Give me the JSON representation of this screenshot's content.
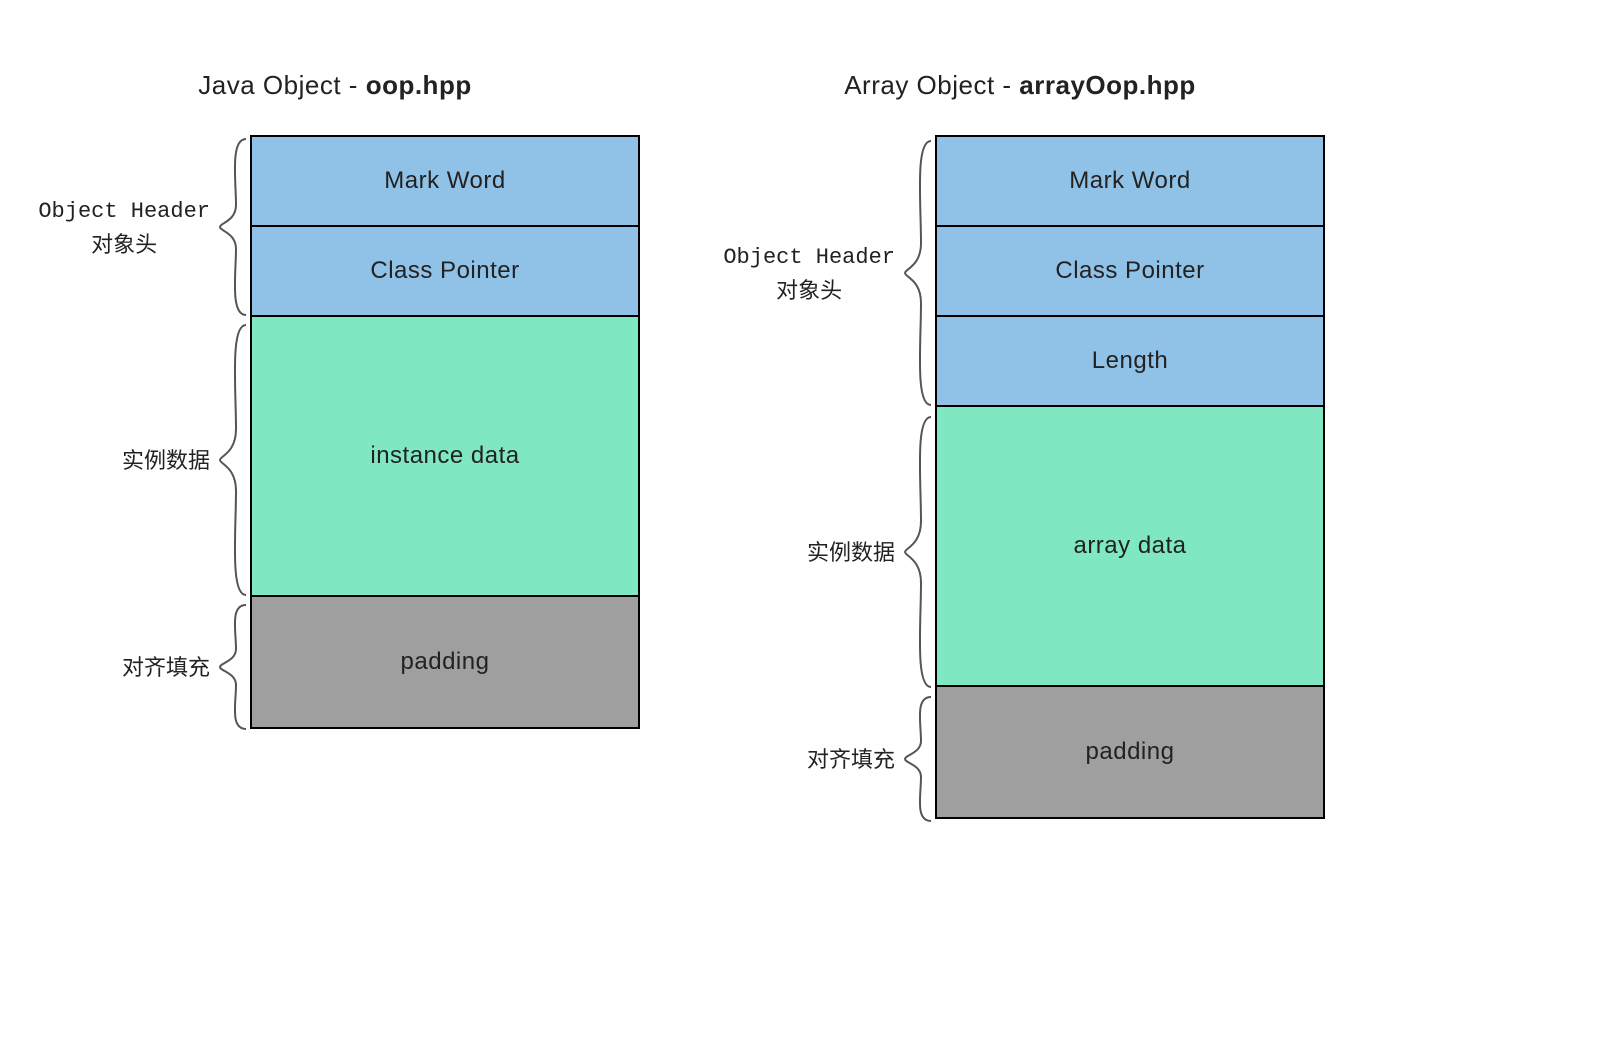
{
  "colors": {
    "header": "#90c1e7",
    "data": "#7fe7c1",
    "padding": "#9f9f9f"
  },
  "left": {
    "title_prefix": "Java Object - ",
    "title_bold": "oop.hpp",
    "sections": {
      "header": {
        "label_en": "Object Header",
        "label_cn": "对象头",
        "cells": [
          "Mark Word",
          "Class Pointer"
        ]
      },
      "data": {
        "label_cn": "实例数据",
        "cells": [
          "instance data"
        ]
      },
      "pad": {
        "label_cn": "对齐填充",
        "cells": [
          "padding"
        ]
      }
    }
  },
  "right": {
    "title_prefix": "Array Object - ",
    "title_bold": "arrayOop.hpp",
    "sections": {
      "header": {
        "label_en": "Object Header",
        "label_cn": "对象头",
        "cells": [
          "Mark Word",
          "Class Pointer",
          "Length"
        ]
      },
      "data": {
        "label_cn": "实例数据",
        "cells": [
          "array data"
        ]
      },
      "pad": {
        "label_cn": "对齐填充",
        "cells": [
          "padding"
        ]
      }
    }
  }
}
